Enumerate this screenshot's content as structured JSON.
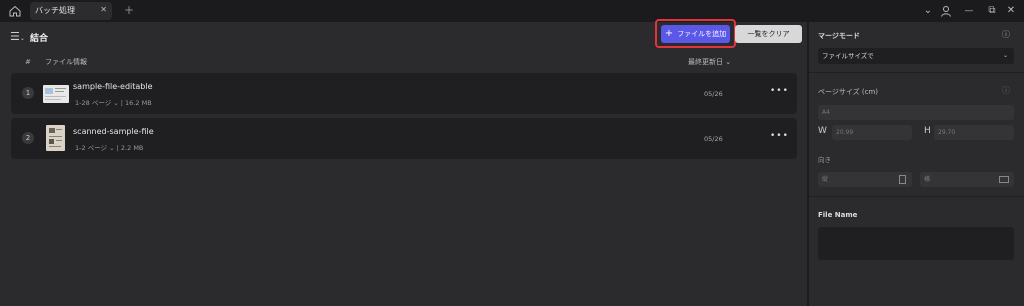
{
  "tabs": [
    {
      "label": "バッチ処理",
      "close": "✕"
    }
  ],
  "tab_add": "+",
  "window_controls": {
    "chevron": "⌄",
    "account": "person-icon",
    "restore": "⧉",
    "close": "✕"
  },
  "toolbar": {
    "title": "結合",
    "add_files_label": "ファイルを追加",
    "add_files_plus": "+",
    "clear_list_label": "一覧をクリア"
  },
  "list_header": {
    "num": "#",
    "file_info": "ファイル情報",
    "last_updated": "最終更新日 ⌄"
  },
  "files": [
    {
      "index": "1",
      "name": "sample-file-editable",
      "pages": "1-28 ページ ⌄",
      "size": "16.2 MB",
      "date": "05/26",
      "more": "•••"
    },
    {
      "index": "2",
      "name": "scanned-sample-file",
      "pages": "1-2 ページ ⌄",
      "size": "2.2 MB",
      "date": "05/26",
      "more": "•••"
    }
  ],
  "side": {
    "merge_mode_label": "マージモード",
    "merge_mode_value": "ファイルサイズで",
    "page_size_label": "ページサイズ (cm)",
    "page_size_value": "A4",
    "width_label": "W",
    "width_value": "20.99",
    "height_label": "H",
    "height_value": "29.70",
    "orientation_label": "向き",
    "portrait_label": "縦",
    "landscape_label": "横",
    "file_name_label": "File Name"
  },
  "colors": {
    "accent": "#5b57e8",
    "highlight": "#e0353e"
  }
}
